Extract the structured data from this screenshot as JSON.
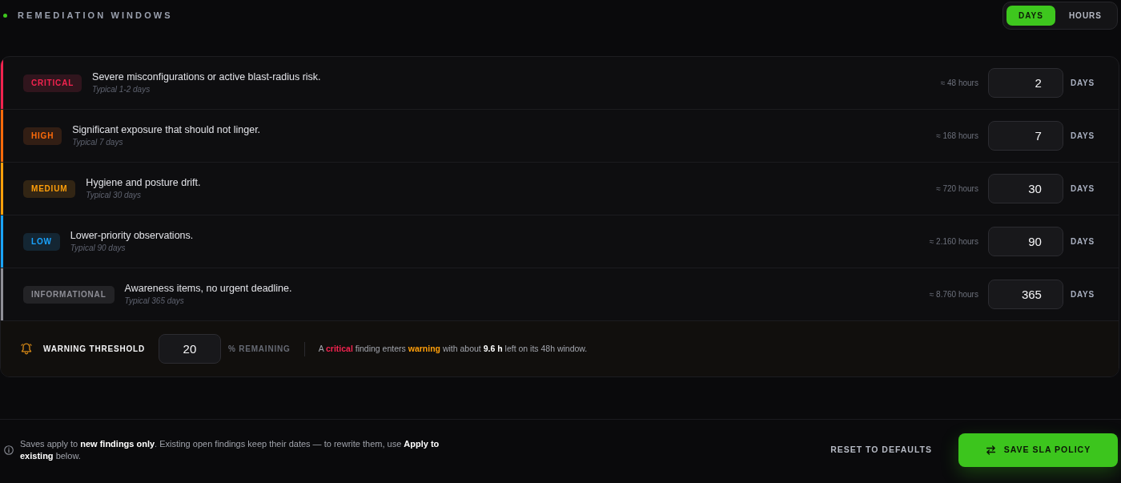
{
  "header": {
    "title": "REMEDIATION WINDOWS"
  },
  "unit_toggle": [
    {
      "label": "DAYS",
      "selected": true
    },
    {
      "label": "HOURS",
      "selected": false
    }
  ],
  "severities": [
    {
      "label": "CRITICAL",
      "color": "#f2234f",
      "description": "Severe misconfigurations or active blast-radius risk.",
      "typical": "Typical 1-2 days",
      "hours": "≈ 48 hours",
      "value": "2",
      "unit": "DAYS"
    },
    {
      "label": "HIGH",
      "color": "#ff6b0a",
      "description": "Significant exposure that should not linger.",
      "typical": "Typical 7 days",
      "hours": "≈ 168 hours",
      "value": "7",
      "unit": "DAYS"
    },
    {
      "label": "MEDIUM",
      "color": "#ff9f0a",
      "description": "Hygiene and posture drift.",
      "typical": "Typical 30 days",
      "hours": "≈ 720 hours",
      "value": "30",
      "unit": "DAYS"
    },
    {
      "label": "LOW",
      "color": "#1aa3ff",
      "description": "Lower-priority observations.",
      "typical": "Typical 90 days",
      "hours": "≈ 2.160 hours",
      "value": "90",
      "unit": "DAYS"
    },
    {
      "label": "INFORMATIONAL",
      "color": "#8e8e96",
      "description": "Awareness items, no urgent deadline.",
      "typical": "Typical 365 days",
      "hours": "≈ 8.760 hours",
      "value": "365",
      "unit": "DAYS"
    }
  ],
  "warning_threshold": {
    "label": "WARNING THRESHOLD",
    "value": "20",
    "suffix": "% REMAINING",
    "message": [
      {
        "kind": "plain",
        "text": "A "
      },
      {
        "kind": "danger",
        "text": "critical"
      },
      {
        "kind": "plain",
        "text": " finding enters "
      },
      {
        "kind": "caution",
        "text": "warning"
      },
      {
        "kind": "plain",
        "text": " with about "
      },
      {
        "kind": "emphasis",
        "text": "9.6 h"
      },
      {
        "kind": "plain",
        "text": " left on its 48h window."
      }
    ]
  },
  "footer": {
    "note": "Saves apply to **new findings only**. Existing open findings keep their dates — to rewrite them, use **Apply to existing** below.",
    "reset_button": "RESET TO DEFAULTS",
    "save_button": "SAVE SLA POLICY"
  }
}
